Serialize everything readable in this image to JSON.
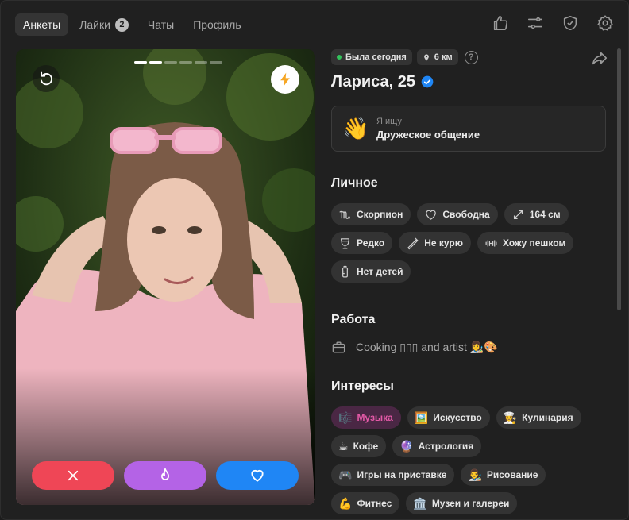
{
  "nav": {
    "tabs": [
      {
        "label": "Анкеты",
        "active": true
      },
      {
        "label": "Лайки",
        "badge": "2"
      },
      {
        "label": "Чаты"
      },
      {
        "label": "Профиль"
      }
    ]
  },
  "top_icons": [
    "thumbs-up-icon",
    "sliders-icon",
    "shield-check-icon",
    "gear-icon"
  ],
  "photo": {
    "progress_total": 6,
    "progress_active": 2
  },
  "profile": {
    "status": "Была сегодня",
    "distance": "6 км",
    "help": "?",
    "name": "Лариса, 25",
    "looking_label": "Я ищу",
    "looking_value": "Дружеское общение",
    "looking_emoji": "👋"
  },
  "personal": {
    "title": "Личное",
    "chips": [
      {
        "label": "Скорпион",
        "icon": "scorpio-icon"
      },
      {
        "label": "Свободна",
        "icon": "heart-outline-icon"
      },
      {
        "label": "164 см",
        "icon": "expand-icon"
      },
      {
        "label": "Редко",
        "icon": "wine-glass-icon"
      },
      {
        "label": "Не курю",
        "icon": "no-smoking-icon"
      },
      {
        "label": "Хожу пешком",
        "icon": "dumbbell-icon"
      },
      {
        "label": "Нет детей",
        "icon": "baby-bottle-icon"
      }
    ]
  },
  "work": {
    "title": "Работа",
    "text": "Cooking ▯▯▯ and artist 👩‍🎨🎨"
  },
  "interests": {
    "title": "Интересы",
    "chips": [
      {
        "label": "Музыка",
        "emoji": "🎼",
        "highlight": true
      },
      {
        "label": "Искусство",
        "emoji": "🖼️"
      },
      {
        "label": "Кулинария",
        "emoji": "👩‍🍳"
      },
      {
        "label": "Кофе",
        "emoji": "☕"
      },
      {
        "label": "Астрология",
        "emoji": "🔮"
      },
      {
        "label": "Игры на приставке",
        "emoji": "🎮"
      },
      {
        "label": "Рисование",
        "emoji": "👨‍🎨"
      },
      {
        "label": "Фитнес",
        "emoji": "💪"
      },
      {
        "label": "Музеи и галереи",
        "emoji": "🏛️"
      }
    ]
  },
  "colors": {
    "accent_blue": "#1f86f5",
    "dislike_red": "#ef4656",
    "super_purple": "#b463e6",
    "online_green": "#33c25b",
    "highlight_pink": "#e55aa8"
  }
}
